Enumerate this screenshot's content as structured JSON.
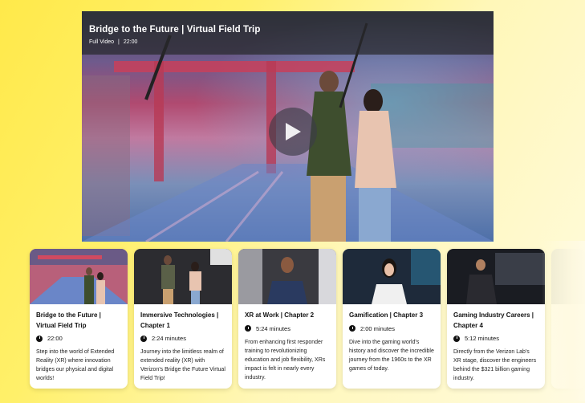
{
  "player": {
    "title": "Bridge to the Future | Virtual Field Trip",
    "type_label": "Full Video",
    "separator": "|",
    "duration": "22:00"
  },
  "cards": [
    {
      "title": "Bridge to the Future | Virtual Field Trip",
      "duration": "22:00",
      "description": "Step into the world of Extended Reality (XR) where innovation bridges our physical and digital worlds!"
    },
    {
      "title": "Immersive Technologies | Chapter 1",
      "duration": "2:24 minutes",
      "description": "Journey into the limitless realm of extended reality (XR) with Verizon's Bridge the Future Virtual Field Trip!"
    },
    {
      "title": "XR at Work | Chapter 2",
      "duration": "5:24 minutes",
      "description": "From enhancing first responder training to revolutionizing education and job flexibility, XRs impact is felt in nearly every industry."
    },
    {
      "title": "Gamification | Chapter 3",
      "duration": "2:00 minutes",
      "description": "Dive into the gaming world's history and discover the incredible journey from the 1960s to the XR games of today."
    },
    {
      "title": "Gaming Industry Careers | Chapter 4",
      "duration": "5:12 minutes",
      "description": "Directly from the Verizon Lab's XR stage, discover the engineers behind the $321 billion gaming industry."
    }
  ],
  "icons": {
    "play": "play-icon",
    "clock": "clock-icon"
  }
}
